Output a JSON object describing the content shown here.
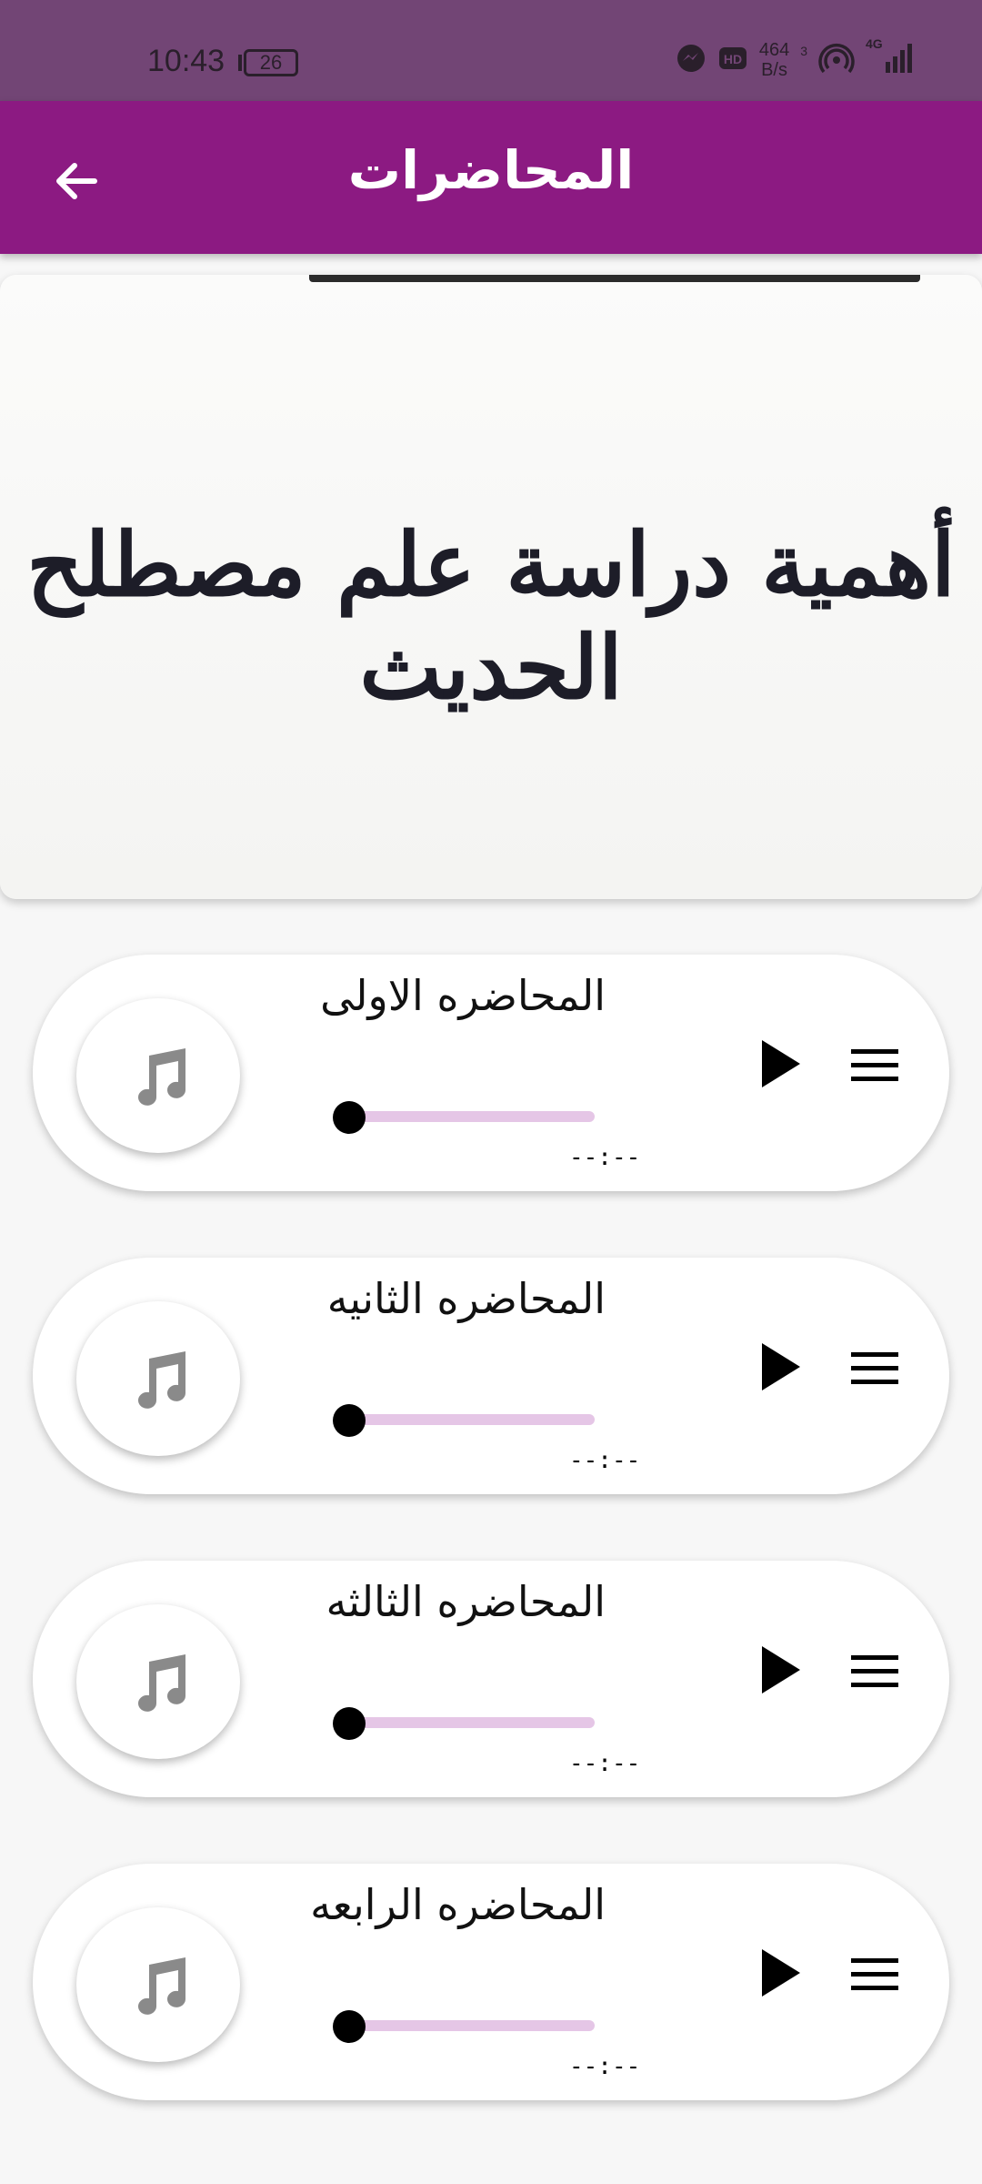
{
  "status_bar": {
    "time": "10:43",
    "battery": "26",
    "net_speed_value": "464",
    "net_speed_unit": "B/s",
    "signal_sup": "3",
    "network_type": "4G",
    "icons": [
      "messenger-icon",
      "hd-icon",
      "hotspot-icon",
      "signal-icon"
    ]
  },
  "app_bar": {
    "title": "المحاضرات",
    "back_icon": "arrow-left-icon"
  },
  "banner": {
    "text": "أهمية دراسة علم مصطلح الحديث"
  },
  "lectures": [
    {
      "title": "المحاضره الاولى",
      "time": "--:--",
      "progress": 0
    },
    {
      "title": "المحاضره الثانيه",
      "time": "--:--",
      "progress": 0
    },
    {
      "title": "المحاضره الثالثه",
      "time": "--:--",
      "progress": 0
    },
    {
      "title": "المحاضره الرابعه",
      "time": "--:--",
      "progress": 0
    }
  ],
  "colors": {
    "status_bar": "#724575",
    "app_bar": "#8c1a82",
    "slider_track": "#e5c6e6",
    "icon_gray": "#8a8a8a"
  }
}
